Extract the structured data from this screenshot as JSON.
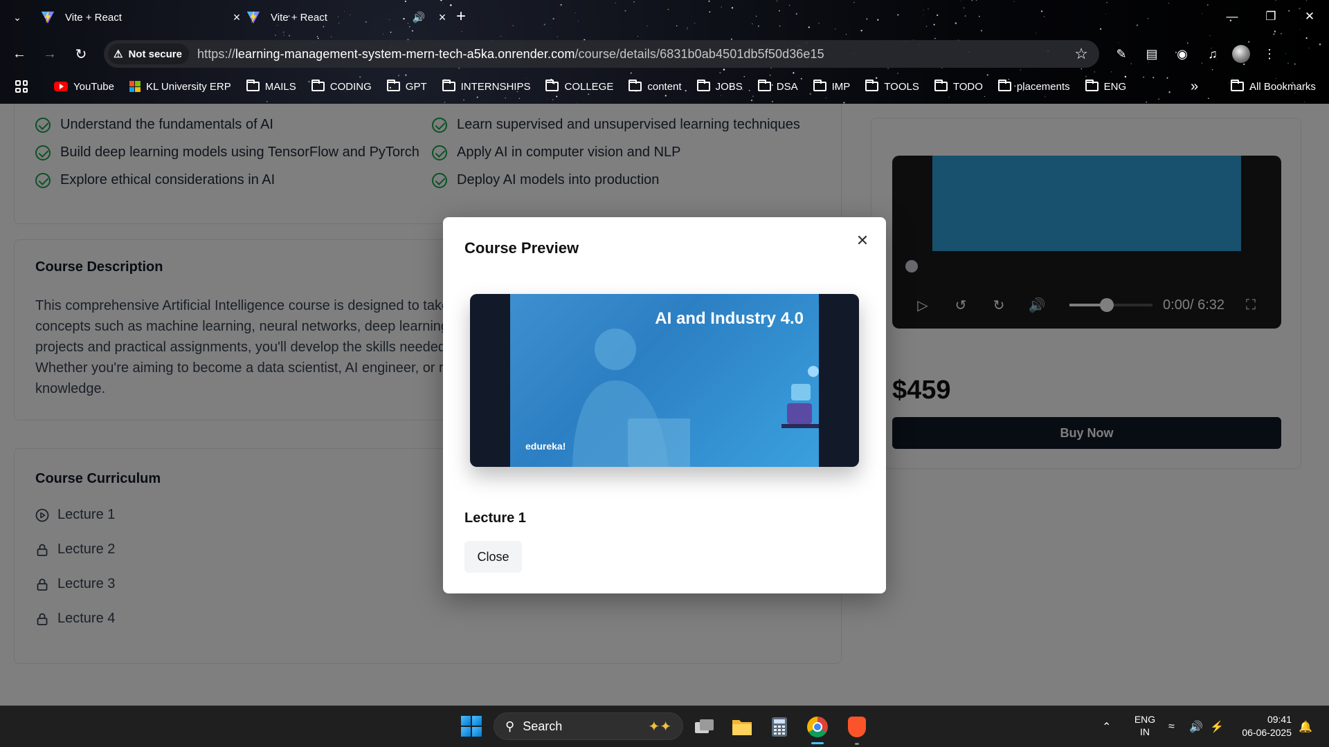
{
  "browser": {
    "tabs": [
      {
        "title": "Vite + React",
        "active": true
      },
      {
        "title": "Vite + React",
        "active": false,
        "audio": true
      }
    ],
    "security_label": "Not secure",
    "url": {
      "scheme": "https://",
      "host": "learning-management-system-mern-tech-a5ka.onrender.com",
      "path": "/course/details/6831b0ab4501db5f50d36e15"
    },
    "bookmarks": [
      {
        "label": "YouTube",
        "icon": "youtube-icon"
      },
      {
        "label": "KL University ERP",
        "icon": "microsoft-icon"
      },
      {
        "label": "MAILS",
        "icon": "folder-icon"
      },
      {
        "label": "CODING",
        "icon": "folder-icon"
      },
      {
        "label": "GPT",
        "icon": "folder-icon"
      },
      {
        "label": "INTERNSHIPS",
        "icon": "folder-icon"
      },
      {
        "label": "COLLEGE",
        "icon": "folder-icon"
      },
      {
        "label": "content",
        "icon": "folder-icon"
      },
      {
        "label": "JOBS",
        "icon": "folder-icon"
      },
      {
        "label": "DSA",
        "icon": "folder-icon"
      },
      {
        "label": "IMP",
        "icon": "folder-icon"
      },
      {
        "label": "TOOLS",
        "icon": "folder-icon"
      },
      {
        "label": "TODO",
        "icon": "folder-icon"
      },
      {
        "label": "placements",
        "icon": "folder-icon"
      },
      {
        "label": "ENG",
        "icon": "folder-icon"
      }
    ],
    "all_bookmarks": "All Bookmarks"
  },
  "page": {
    "outcomes": [
      "Understand the fundamentals of AI",
      "Learn supervised and unsupervised learning techniques",
      "Build deep learning models using TensorFlow and PyTorch",
      "Apply AI in computer vision and NLP",
      "Explore ethical considerations in AI",
      "Deploy AI models into production"
    ],
    "description": {
      "heading": "Course Description",
      "lines": [
        "This comprehensive Artificial Intelligence course is designed to take",
        "concepts such as machine learning, neural networks, deep learning",
        "projects and practical assignments, you'll develop the skills needed",
        "Whether you're aiming to become a data scientist, AI engineer, or r",
        "knowledge."
      ]
    },
    "curriculum": {
      "heading": "Course Curriculum",
      "lectures": [
        {
          "title": "Lecture 1",
          "icon": "play-circle-icon"
        },
        {
          "title": "Lecture 2",
          "icon": "lock-icon"
        },
        {
          "title": "Lecture 3",
          "icon": "lock-icon"
        },
        {
          "title": "Lecture 4",
          "icon": "lock-icon"
        }
      ]
    },
    "player": {
      "time": "0:00/ 6:32",
      "volume_fraction": 0.45
    },
    "price": "$459",
    "buy_label": "Buy Now"
  },
  "modal": {
    "title": "Course Preview",
    "thumbnail_title": "AI and Industry 4.0",
    "thumbnail_logo": "edureka!",
    "lecture_name": "Lecture 1",
    "close_label": "Close"
  },
  "taskbar": {
    "search_placeholder": "Search",
    "lang_line1": "ENG",
    "lang_line2": "IN",
    "time": "09:41",
    "date": "06-06-2025"
  },
  "colors": {
    "accent_check": "#16a34a",
    "buy_button": "#111827",
    "overlay": "rgba(0,0,0,0.5)"
  }
}
